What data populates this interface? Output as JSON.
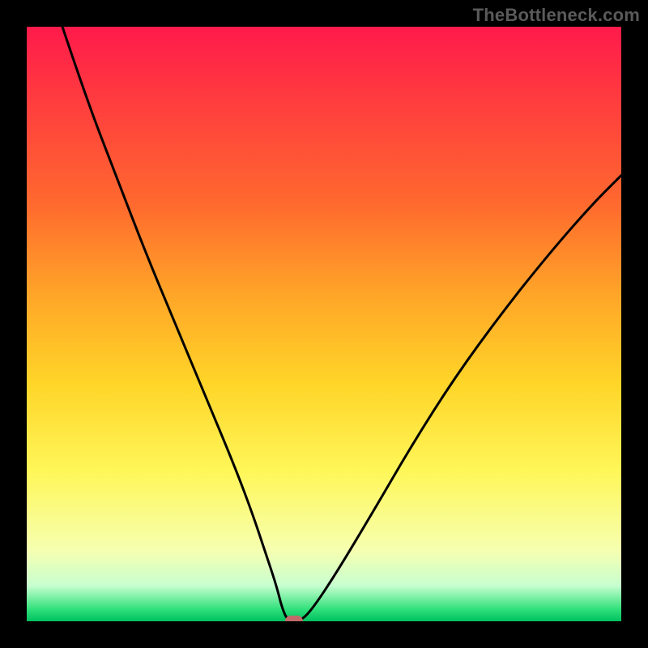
{
  "watermark": "TheBottleneck.com",
  "chart_data": {
    "type": "line",
    "title": "",
    "xlabel": "",
    "ylabel": "",
    "xlim": [
      0,
      100
    ],
    "ylim": [
      0,
      100
    ],
    "grid": false,
    "legend": null,
    "series": [
      {
        "name": "curve",
        "color": "#000000",
        "x": [
          6,
          10,
          15,
          20,
          25,
          30,
          35,
          38,
          40,
          42,
          43,
          44,
          46,
          48,
          52,
          58,
          65,
          72,
          80,
          88,
          95,
          100
        ],
        "y": [
          100,
          88,
          75,
          62,
          50,
          38,
          26,
          18,
          12,
          6,
          2,
          0,
          0,
          2,
          8,
          18,
          30,
          41,
          52,
          62,
          70,
          75
        ]
      }
    ],
    "marker": {
      "x": 45,
      "y": 0,
      "color": "#c26a6a"
    },
    "background_gradient": {
      "direction": "vertical",
      "stops": [
        {
          "pos": 0.0,
          "color": "#ff1a4b"
        },
        {
          "pos": 0.3,
          "color": "#ff6a2e"
        },
        {
          "pos": 0.6,
          "color": "#ffd528"
        },
        {
          "pos": 0.88,
          "color": "#f6ffb0"
        },
        {
          "pos": 1.0,
          "color": "#00c060"
        }
      ]
    }
  }
}
